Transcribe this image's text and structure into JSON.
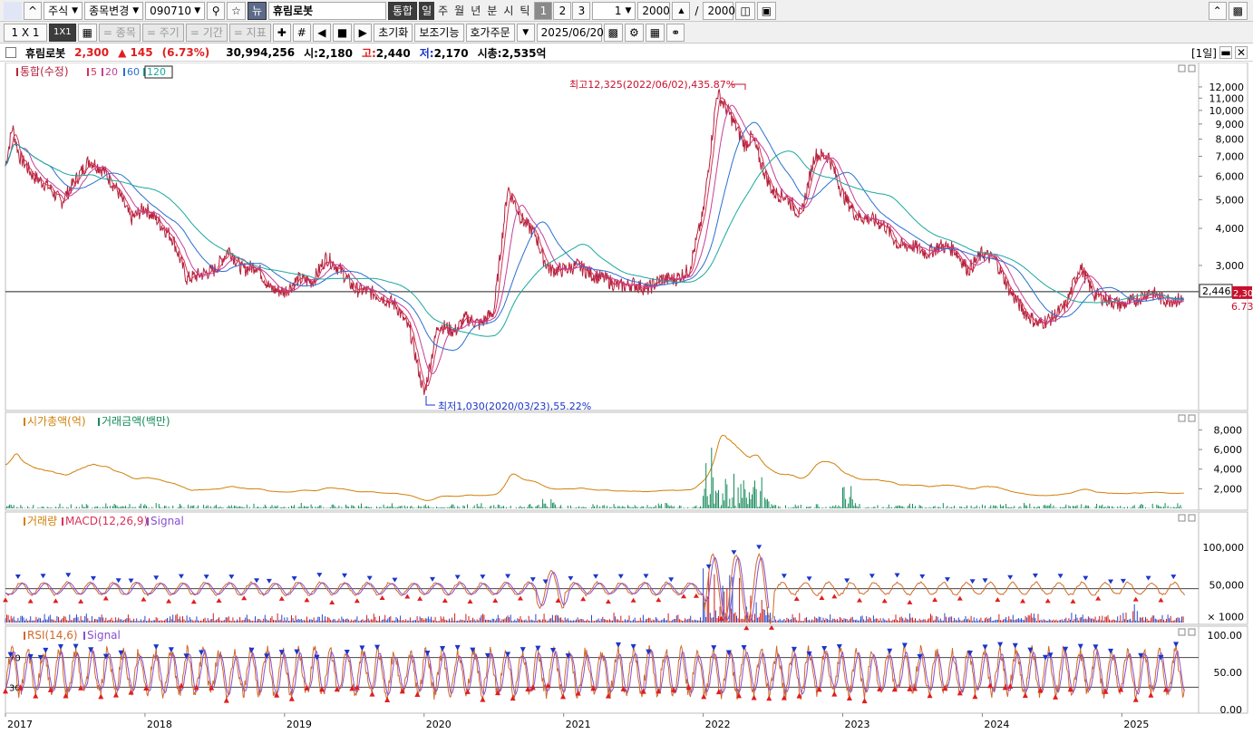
{
  "toolbar1": {
    "market": "주식",
    "change_label": "종목변경",
    "code": "090710",
    "news_badge": "뉴",
    "stock_name": "휴림로봇",
    "integrated": "통합",
    "periods": [
      "일",
      "주",
      "월",
      "년",
      "분",
      "시",
      "틱"
    ],
    "nums": [
      "1",
      "2",
      "3"
    ],
    "interval": "1",
    "count": "2000",
    "slash": "/",
    "total": "2000"
  },
  "toolbar2": {
    "layout": "1 X 1",
    "layout_btn": "1X1",
    "items": [
      "= 종목",
      "= 주기",
      "= 기간",
      "= 지표"
    ],
    "reset": "초기화",
    "aux": "보조기능",
    "order": "호가주문",
    "date": "2025/06/20"
  },
  "info": {
    "name": "휴림로봇",
    "price": "2,300",
    "change": "▲  145",
    "pct": "(6.73%)",
    "volume": "30,994,256",
    "open_label": "시:",
    "open": "2,180",
    "high_label": "고:",
    "high": "2,440",
    "low_label": "저:",
    "low": "2,170",
    "mcap_label": "시총:",
    "mcap": "2,535억",
    "period_tag": "[1일]"
  },
  "colors": {
    "up": "#e01e1e",
    "down": "#1c35c9",
    "ma5": "#d8305a",
    "ma20": "#c3409a",
    "ma60": "#2a6fd0",
    "ma120": "#1aa89a",
    "mcap": "#d0800a",
    "amount": "#168a5a",
    "rsi": "#cf6a2a",
    "signal": "#8a4fd0"
  },
  "chart_data": [
    {
      "type": "line",
      "title": "통합(수정)",
      "legend": [
        "5",
        "20",
        "60",
        "120"
      ],
      "x_ticks": [
        "2017",
        "2018",
        "2019",
        "2020",
        "2021",
        "2022",
        "2023",
        "2024",
        "2025"
      ],
      "y_ticks": [
        "3,000",
        "4,000",
        "5,000",
        "6,000",
        "7,000",
        "8,000",
        "9,000",
        "10,000",
        "11,000",
        "12,000"
      ],
      "ylim": [
        1000,
        12600
      ],
      "log_scale": true,
      "annot_high": "최고12,325(2022/06/02),435.87%",
      "annot_low": "최저1,030(2020/03/23),55.22%",
      "cursor_value": "2,446",
      "last_price": "2,300",
      "last_pct": "6.73%",
      "series": [
        {
          "x": [
            2017.0,
            2017.05,
            2017.1,
            2017.2,
            2017.3,
            2017.4,
            2017.5,
            2017.6,
            2017.7,
            2017.8,
            2017.9,
            2018.0,
            2018.1,
            2018.2,
            2018.3,
            2018.4,
            2018.5,
            2018.6,
            2018.7,
            2018.8,
            2018.9,
            2019.0,
            2019.1,
            2019.2,
            2019.3,
            2019.4,
            2019.5,
            2019.6,
            2019.7,
            2019.8,
            2019.9,
            2020.0,
            2020.1,
            2020.22,
            2020.3,
            2020.4,
            2020.5,
            2020.6,
            2020.7,
            2020.8,
            2020.85,
            2020.9,
            2021.0,
            2021.1,
            2021.2,
            2021.3,
            2021.4,
            2021.5,
            2021.6,
            2021.7,
            2021.8,
            2021.9,
            2022.0,
            2022.1,
            2022.2,
            2022.3,
            2022.35,
            2022.42,
            2022.5,
            2022.6,
            2022.7,
            2022.8,
            2022.9,
            2023.0,
            2023.05,
            2023.1,
            2023.2,
            2023.3,
            2023.4,
            2023.5,
            2023.6,
            2023.7,
            2023.8,
            2023.9,
            2024.0,
            2024.1,
            2024.2,
            2024.3,
            2024.4,
            2024.5,
            2024.6,
            2024.7,
            2024.8,
            2024.9,
            2025.0,
            2025.05,
            2025.1,
            2025.2,
            2025.3,
            2025.4,
            2025.45
          ],
          "y": [
            6500,
            8800,
            7000,
            6000,
            5600,
            4900,
            5800,
            6800,
            6300,
            5400,
            4300,
            4700,
            4200,
            3700,
            2700,
            2800,
            2900,
            3400,
            2900,
            3000,
            2500,
            2450,
            2700,
            2650,
            3200,
            2900,
            2500,
            2450,
            2350,
            2200,
            1800,
            1100,
            1900,
            1800,
            2000,
            1900,
            2100,
            5500,
            4300,
            3800,
            3200,
            2900,
            2900,
            3000,
            2800,
            2700,
            2550,
            2600,
            2500,
            2700,
            2700,
            2900,
            4500,
            11500,
            9500,
            7600,
            8200,
            6500,
            5300,
            5100,
            4400,
            7100,
            7000,
            5200,
            4800,
            4400,
            4300,
            4100,
            3500,
            3500,
            3300,
            3500,
            3400,
            2900,
            3300,
            3100,
            2450,
            2100,
            1900,
            2000,
            2200,
            3000,
            2400,
            2300,
            2200,
            2250,
            2300,
            2450,
            2300,
            2300,
            2300
          ]
        }
      ]
    },
    {
      "type": "area",
      "title": "시가총액(억)",
      "legend2": "거래금액(백만)",
      "y_ticks": [
        "2,000",
        "4,000",
        "6,000",
        "8,000"
      ],
      "ylim": [
        0,
        8000
      ]
    },
    {
      "type": "line",
      "title": "거래량",
      "legend2": "MACD(12,26,9)",
      "legend3": "Signal",
      "y_ticks": [
        "× 1000",
        "50,000",
        "100,000"
      ],
      "ylim": [
        0,
        130000
      ]
    },
    {
      "type": "line",
      "title": "RSI(14,6)",
      "legend2": "Signal",
      "y_ticks": [
        "0.00",
        "50.00",
        "100.00"
      ],
      "ylim": [
        0,
        100
      ],
      "levels": [
        "70",
        "30"
      ]
    }
  ]
}
